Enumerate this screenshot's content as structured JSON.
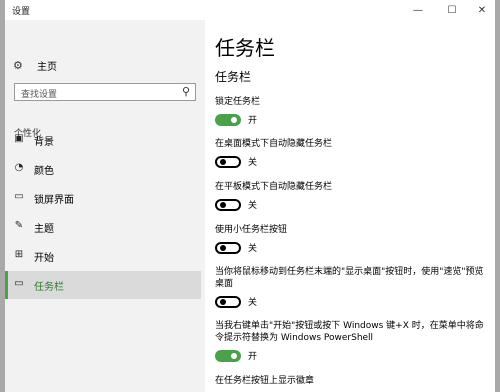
{
  "window": {
    "title": "设置",
    "controls": {
      "minimize": "—",
      "maximize": "☐",
      "close": "✕"
    }
  },
  "sidebar": {
    "home_label": "主页",
    "search_placeholder": "查找设置",
    "section_header": "个性化",
    "items": [
      {
        "label": "背景",
        "icon": "image-icon"
      },
      {
        "label": "颜色",
        "icon": "palette-icon"
      },
      {
        "label": "锁屏界面",
        "icon": "lock-screen-icon"
      },
      {
        "label": "主题",
        "icon": "theme-icon"
      },
      {
        "label": "开始",
        "icon": "start-icon"
      },
      {
        "label": "任务栏",
        "icon": "taskbar-icon",
        "active": true
      }
    ]
  },
  "main": {
    "page_title": "任务栏",
    "section_title": "任务栏",
    "settings": [
      {
        "label": "锁定任务栏",
        "state": "开",
        "on": true
      },
      {
        "label": "在桌面模式下自动隐藏任务栏",
        "state": "关",
        "on": false
      },
      {
        "label": "在平板模式下自动隐藏任务栏",
        "state": "关",
        "on": false
      },
      {
        "label": "使用小任务栏按钮",
        "state": "关",
        "on": false
      },
      {
        "label": "当你将鼠标移动到任务栏末端的\"显示桌面\"按钮时，使用\"速览\"预览桌面",
        "state": "关",
        "on": false
      },
      {
        "label": "当我右键单击\"开始\"按钮或按下 Windows 键+X 时，在菜单中将命令提示符替换为 Windows PowerShell",
        "state": "开",
        "on": true
      },
      {
        "label": "在任务栏按钮上显示徽章"
      }
    ]
  },
  "colors": {
    "accent": "#4aa14a",
    "sidebar_bg": "#f2f2f2",
    "active_bg": "#dadada"
  }
}
